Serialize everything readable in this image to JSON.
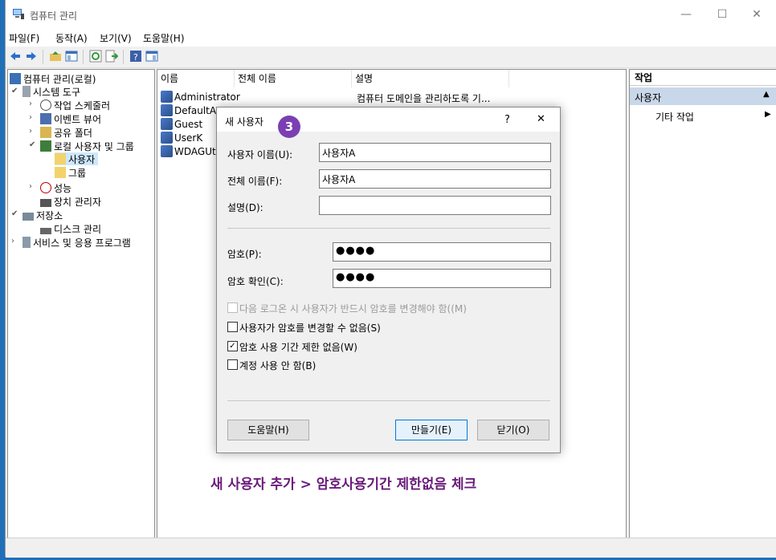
{
  "window": {
    "title": "컴퓨터 관리"
  },
  "menu": [
    "파일(F)",
    "동작(A)",
    "보기(V)",
    "도움말(H)"
  ],
  "tree": {
    "root": "컴퓨터 관리(로컬)",
    "system_tools": "시스템 도구",
    "task_scheduler": "작업 스케줄러",
    "event_viewer": "이벤트 뷰어",
    "shared_folders": "공유 폴더",
    "local_users": "로컬 사용자 및 그룹",
    "users": "사용자",
    "groups": "그룹",
    "performance": "성능",
    "device_manager": "장치 관리자",
    "storage": "저장소",
    "disk_management": "디스크 관리",
    "services": "서비스 및 응용 프로그램"
  },
  "list": {
    "columns": [
      "이름",
      "전체 이름",
      "설명"
    ],
    "rows": [
      {
        "name": "Administrator",
        "desc": "컴퓨터 도메인을 관리하도록 기..."
      },
      {
        "name": "DefaultAc"
      },
      {
        "name": "Guest"
      },
      {
        "name": "UserK"
      },
      {
        "name": "WDAGUtil"
      }
    ]
  },
  "actions": {
    "header": "작업",
    "section": "사용자",
    "more": "기타 작업"
  },
  "dialog": {
    "title": "새 사용자",
    "help_mark": "?",
    "close": "✕",
    "step_badge": "3",
    "username_label": "사용자 이름(U):",
    "username_value": "사용자A",
    "fullname_label": "전체 이름(F):",
    "fullname_value": "사용자A",
    "desc_label": "설명(D):",
    "desc_value": "",
    "password_label": "암호(P):",
    "password_value": "●●●●",
    "confirm_label": "암호 확인(C):",
    "confirm_value": "●●●●",
    "cb_must_change": {
      "label": "다음 로그온 시 사용자가 반드시 암호를 변경해야 함((M)",
      "checked": false,
      "disabled": true
    },
    "cb_cannot_change": {
      "label": "사용자가 암호를 변경할 수 없음(S)",
      "checked": false
    },
    "cb_never_expires": {
      "label": "암호 사용 기간 제한 없음(W)",
      "checked": true
    },
    "cb_disabled": {
      "label": "계정 사용 안 함(B)",
      "checked": false
    },
    "help_button": "도움말(H)",
    "create_button": "만들기(E)",
    "close_button": "닫기(O)"
  },
  "caption": "새 사용자 추가 > 암호사용기간 제한없음 체크",
  "colors": {
    "caption": "#6a1b7a",
    "badge": "#7b3fb3",
    "selection": "#cce8ff",
    "actions_header": "#c9d7ea"
  }
}
